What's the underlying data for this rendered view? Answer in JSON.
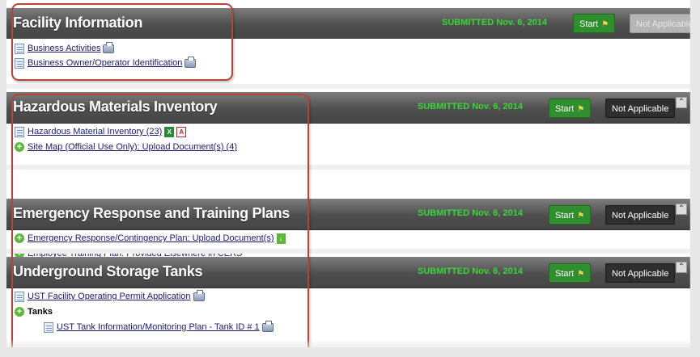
{
  "sections": {
    "facility": {
      "title": "Facility Information",
      "status": "SUBMITTED Nov. 6, 2014",
      "start": "Start",
      "not_applicable": "Not Applicable",
      "items": [
        "Business Activities",
        "Business Owner/Operator Identification"
      ]
    },
    "hazmat": {
      "title": "Hazardous Materials Inventory",
      "status": "SUBMITTED Nov. 6, 2014",
      "start": "Start",
      "not_applicable": "Not Applicable",
      "items": [
        "Hazardous Material Inventory (23)",
        "Site Map (Official Use Only): Upload Document(s) (4)"
      ]
    },
    "emergency": {
      "title": "Emergency Response and Training Plans",
      "status": "SUBMITTED Nov. 6, 2014",
      "start": "Start",
      "not_applicable": "Not Applicable",
      "items": [
        "Emergency Response/Contingency Plan: Upload Document(s)",
        "Employee Training Plan: Provided Elsewhere in CERS"
      ]
    },
    "ust": {
      "title": "Underground Storage Tanks",
      "status": "SUBMITTED Nov. 6, 2014",
      "start": "Start",
      "not_applicable": "Not Applicable",
      "items": [
        "UST Facility Operating Permit Application",
        "Tanks",
        "UST Tank Information/Monitoring Plan - Tank ID # 1"
      ]
    }
  },
  "icons": {
    "document": "document-icon",
    "printer": "printer-icon",
    "add": "plus-circle-icon",
    "excel": "excel-icon",
    "pdf": "pdf-icon",
    "download": "download-icon",
    "flag": "flag-icon"
  },
  "colors": {
    "status_green": "#36d836",
    "start_button": "#2f8f2f",
    "header_gray": "#4e4e4e",
    "highlight_outline": "#b5443a"
  }
}
